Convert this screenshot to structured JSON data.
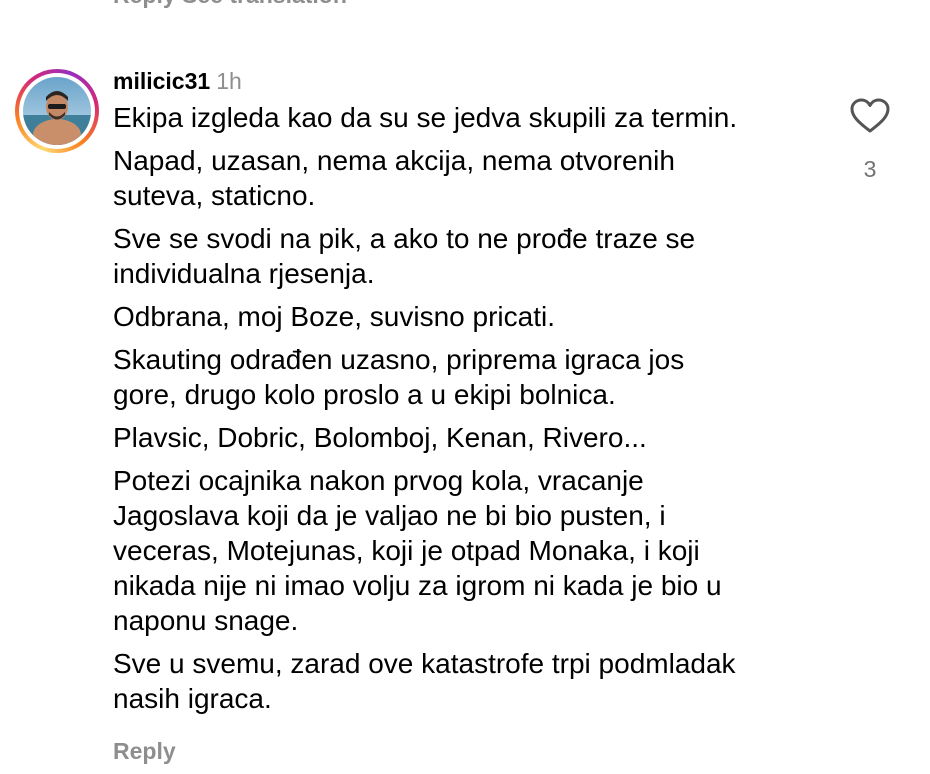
{
  "previous_comment": {
    "actions_text": "Reply   See translation"
  },
  "comment": {
    "username": "milicic31",
    "time": "1h",
    "paragraphs": [
      "Ekipa izgleda kao da su se jedva skupili za termin.",
      "Napad, uzasan, nema akcija, nema otvorenih\nsuteva, staticno.",
      "Sve se svodi na pik, a ako to ne prođe traze se\nindividualna rjesenja.",
      "Odbrana, moj Boze, suvisno pricati.",
      "Skauting odrađen uzasno, priprema igraca jos\ngore, drugo kolo proslo a u ekipi bolnica.",
      "Plavsic, Dobric, Bolomboj, Kenan, Rivero...",
      "Potezi ocajnika nakon prvog kola, vracanje\nJagoslava koji da je valjao ne bi bio pusten, i\nveceras, Motejunas, koji je otpad Monaka, i koji\nnikada nije ni imao volju za igrom ni kada je bio u\nnaponu snage.",
      "Sve u svemu, zarad ove katastrofe trpi podmladak\nnasih igraca."
    ],
    "reply_label": "Reply",
    "like_count": "3",
    "like_icon": "heart-outline-icon"
  },
  "colors": {
    "text": "#000000",
    "secondary": "#8e8e8e",
    "ring_gradient": [
      "#feda75",
      "#fa7e1e",
      "#d62976",
      "#962fbf"
    ]
  }
}
